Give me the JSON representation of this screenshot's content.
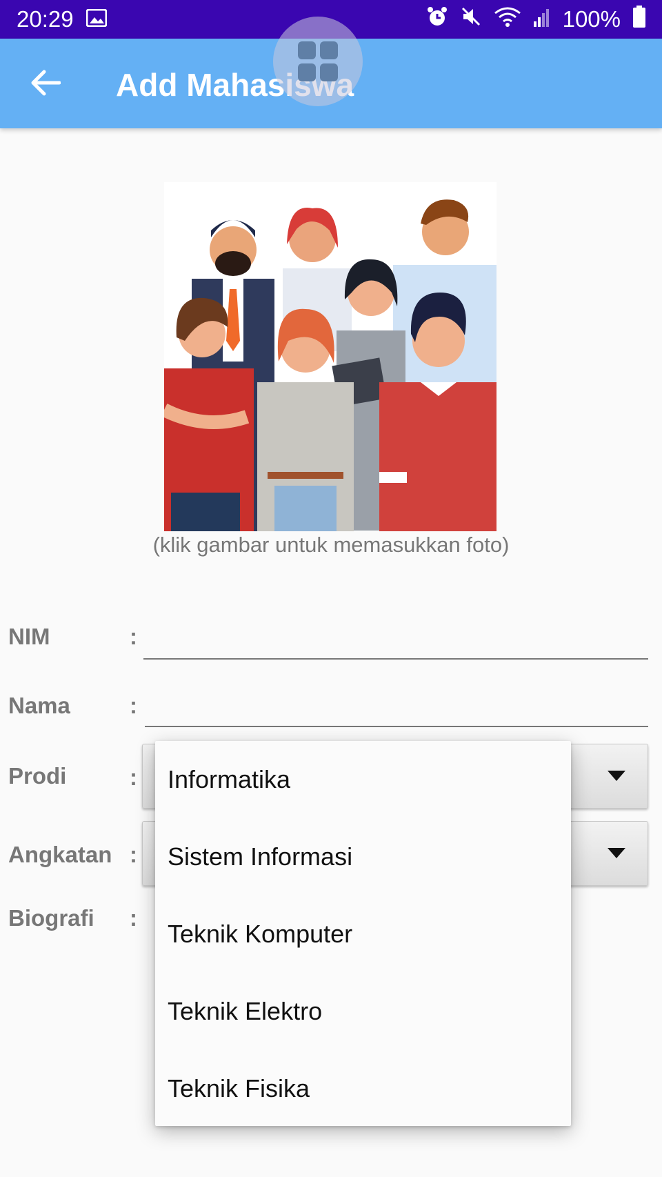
{
  "status_bar": {
    "time": "20:29",
    "battery": "100%",
    "icons": [
      "image-icon",
      "alarm-icon",
      "mute-icon",
      "wifi-icon",
      "signal-icon",
      "battery-icon"
    ]
  },
  "app_bar": {
    "title": "Add Mahasiswa",
    "back_icon": "arrow-back-icon",
    "color": "#64b0f4"
  },
  "photo": {
    "caption": "(klik gambar untuk memasukkan foto)"
  },
  "form": {
    "nim": {
      "label": "NIM",
      "colon": ":",
      "value": ""
    },
    "nama": {
      "label": "Nama",
      "colon": ":",
      "value": ""
    },
    "prodi": {
      "label": "Prodi",
      "colon": ":"
    },
    "angkatan": {
      "label": "Angkatan",
      "colon": ":"
    },
    "biografi": {
      "label": "Biografi",
      "colon": ":"
    }
  },
  "prodi_dropdown": {
    "options": [
      "Informatika",
      "Sistem Informasi",
      "Teknik Komputer",
      "Teknik Elektro",
      "Teknik Fisika"
    ]
  }
}
